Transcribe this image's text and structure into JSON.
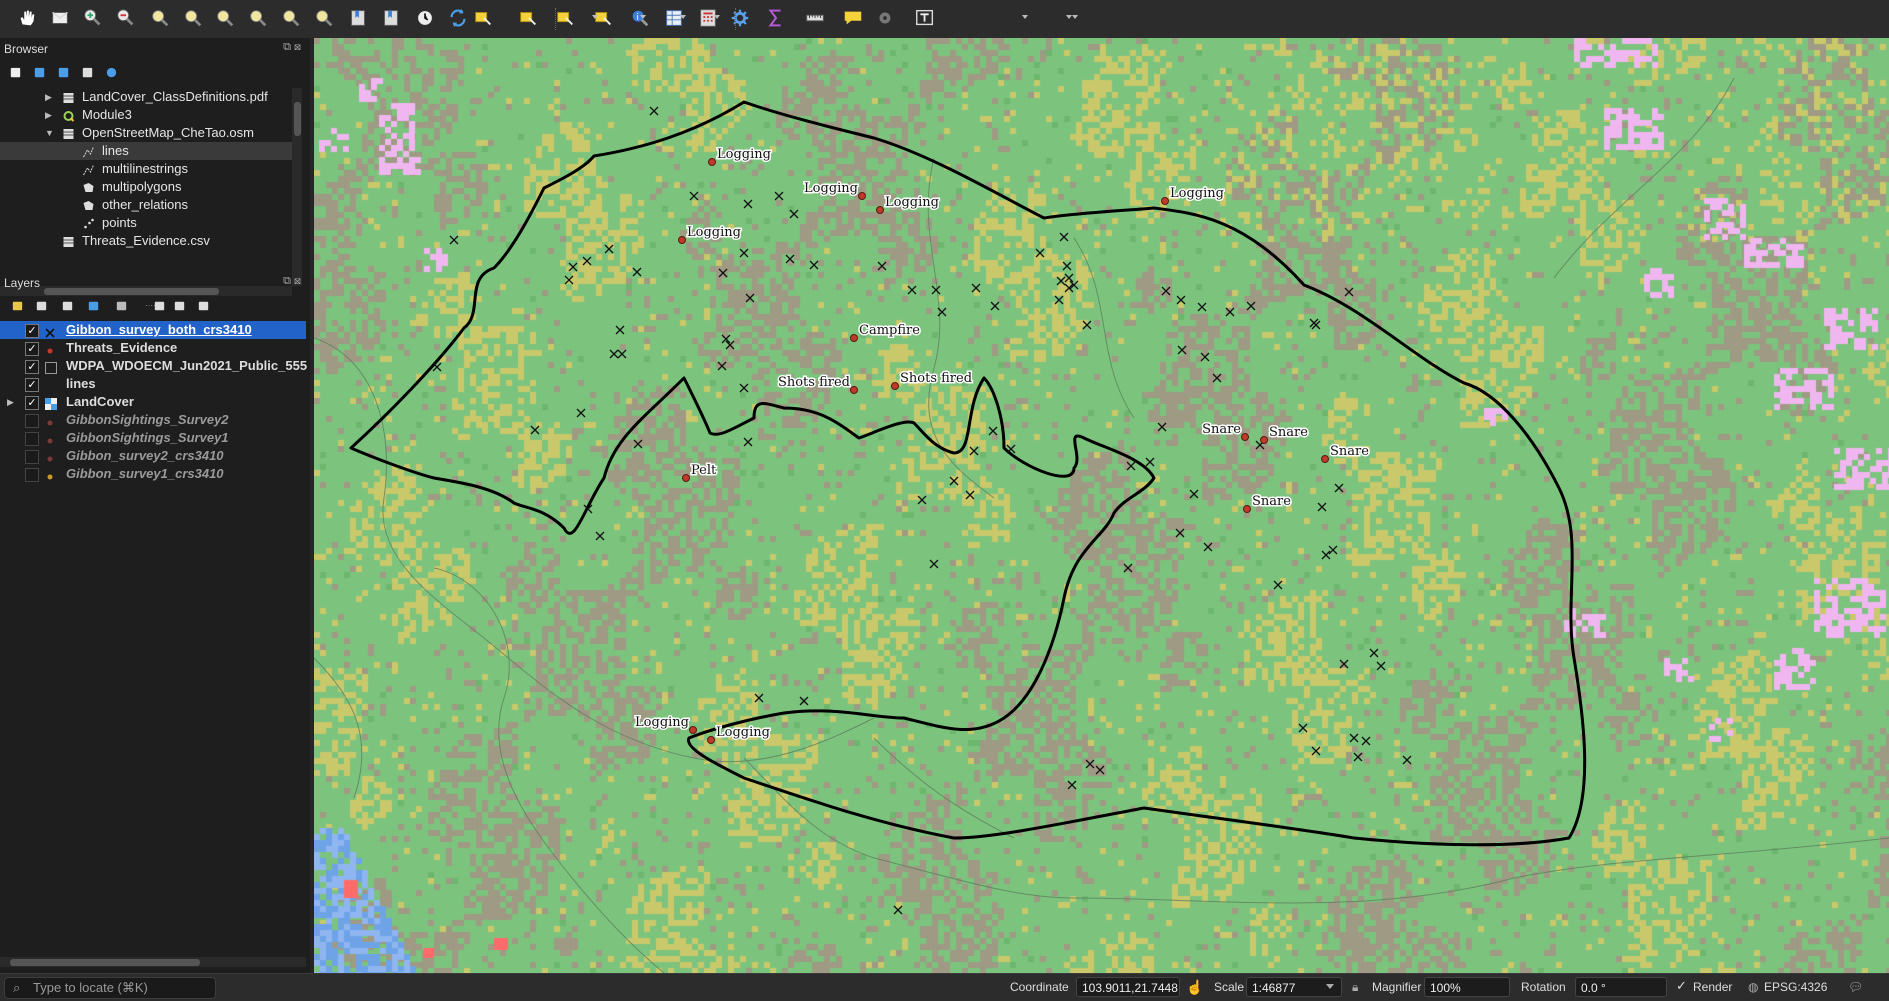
{
  "toolbar": {
    "icons": [
      "pan-hand-icon",
      "pan-to-selection-icon",
      "zoom-in-icon",
      "zoom-out-icon",
      "zoom-full-icon",
      "zoom-to-selection-icon",
      "zoom-to-layer-icon",
      "zoom-native-icon",
      "zoom-last-icon",
      "zoom-next-icon",
      "new-bookmark-icon",
      "show-bookmarks-icon",
      "temporal-controller-icon",
      "refresh-icon",
      "select-features-icon",
      "select-by-value-icon",
      "deselect-icon",
      "select-by-location-icon",
      "identify-icon",
      "attribute-table-icon",
      "field-calculator-icon",
      "processing-toolbox-icon",
      "statistics-sigma-icon",
      "measure-line-icon",
      "map-tips-icon",
      "decorations-icon",
      "text-annotation-icon"
    ]
  },
  "browser": {
    "title": "Browser",
    "items": [
      {
        "label": "LandCover_ClassDefinitions.pdf",
        "icon": "file-icon"
      },
      {
        "label": "Module3",
        "icon": "qgis-project-icon"
      },
      {
        "label": "OpenStreetMap_CheTao.osm",
        "icon": "database-icon"
      },
      {
        "label": "lines",
        "icon": "line-layer-icon"
      },
      {
        "label": "multilinestrings",
        "icon": "line-layer-icon"
      },
      {
        "label": "multipolygons",
        "icon": "polygon-layer-icon"
      },
      {
        "label": "other_relations",
        "icon": "polygon-layer-icon"
      },
      {
        "label": "points",
        "icon": "point-layer-icon"
      },
      {
        "label": "Threats_Evidence.csv",
        "icon": "table-icon"
      }
    ]
  },
  "layers": {
    "title": "Layers",
    "items": [
      {
        "label": "Gibbon_survey_both_crs3410",
        "checked": true,
        "selected": true,
        "symbol": "x-marker",
        "active": true
      },
      {
        "label": "Threats_Evidence",
        "checked": true,
        "symbol": "dot-red",
        "active": true
      },
      {
        "label": "WDPA_WDOECM_Jun2021_Public_555",
        "checked": true,
        "symbol": "polygon-outline",
        "active": true
      },
      {
        "label": "lines",
        "checked": true,
        "symbol": "none",
        "active": true
      },
      {
        "label": "LandCover",
        "checked": true,
        "symbol": "raster",
        "active": true
      },
      {
        "label": "GibbonSightings_Survey2",
        "checked": false,
        "symbol": "dot-red",
        "active": false
      },
      {
        "label": "GibbonSightings_Survey1",
        "checked": false,
        "symbol": "dot-red",
        "active": false
      },
      {
        "label": "Gibbon_survey2_crs3410",
        "checked": false,
        "symbol": "dot-red",
        "active": false
      },
      {
        "label": "Gibbon_survey1_crs3410",
        "checked": false,
        "symbol": "dot-orange",
        "active": false
      }
    ]
  },
  "map": {
    "threat_labels": [
      "Logging",
      "Logging",
      "Logging",
      "Logging",
      "Logging",
      "Campfire",
      "Shots fired",
      "Shots fired",
      "Pelt",
      "Snare",
      "Snare",
      "Snare",
      "Snare",
      "Logging",
      "Logging"
    ],
    "colors": {
      "forest": "#7cc47e",
      "cropland": "#c9c86a",
      "bare": "#9e9a84",
      "urban": "#f0b6f0",
      "water": "#6fa3e8",
      "boundary": "#000000",
      "threat": "#c0392b"
    }
  },
  "status": {
    "locate_placeholder": "Type to locate (⌘K)",
    "coordinate_label": "Coordinate",
    "coordinate_value": "103.9011,21.7448",
    "scale_label": "Scale",
    "scale_value": "1:46877",
    "magnifier_label": "Magnifier",
    "magnifier_value": "100%",
    "rotation_label": "Rotation",
    "rotation_value": "0.0 °",
    "render_label": "Render",
    "crs": "EPSG:4326"
  }
}
